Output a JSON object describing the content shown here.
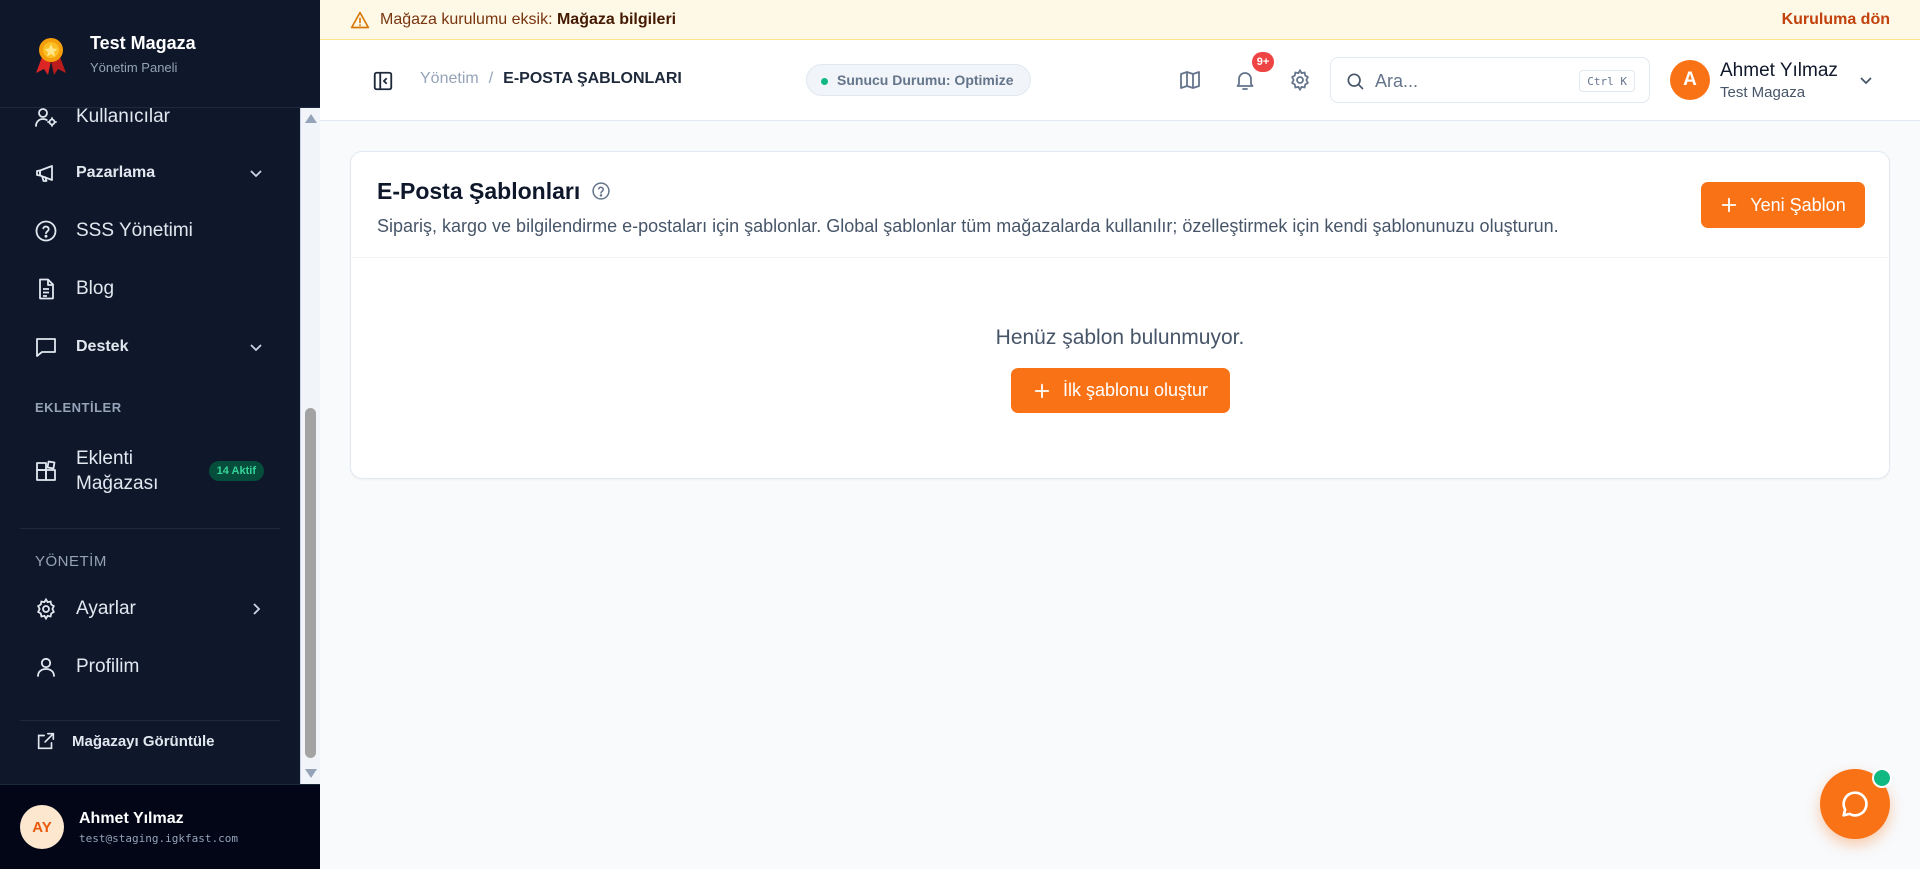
{
  "brand": {
    "title": "Test Magaza",
    "subtitle": "Yönetim Paneli"
  },
  "sidebar": {
    "items": [
      {
        "label": "Kullanıcılar",
        "icon": "users-gear-icon"
      },
      {
        "label": "Pazarlama",
        "icon": "megaphone-icon"
      },
      {
        "label": "SSS Yönetimi",
        "icon": "help-circle-icon"
      },
      {
        "label": "Blog",
        "icon": "file-text-icon"
      },
      {
        "label": "Destek",
        "icon": "message-square-icon"
      }
    ],
    "sections": {
      "plugins": "EKLENTİLER",
      "admin": "YÖNETİM"
    },
    "plugin_store": {
      "label": "Eklenti Mağazası",
      "badge": "14 Aktif"
    },
    "admin_items": [
      {
        "label": "Ayarlar",
        "icon": "gear-icon"
      },
      {
        "label": "Profilim",
        "icon": "user-icon"
      }
    ],
    "view_store": "Mağazayı Görüntüle"
  },
  "sidebar_user": {
    "initials": "AY",
    "name": "Ahmet Yılmaz",
    "email": "test@staging.igkfast.com"
  },
  "banner": {
    "text": "Mağaza kurulumu eksik:",
    "strong": "Mağaza bilgileri",
    "action": "Kuruluma dön"
  },
  "topbar": {
    "breadcrumb_root": "Yönetim",
    "breadcrumb_sep": "/",
    "breadcrumb_current": "E-POSTA ŞABLONLARI",
    "server_status": "Sunucu Durumu: Optimize",
    "notifications_badge": "9+",
    "search_placeholder": "Ara...",
    "search_shortcut": "Ctrl K",
    "user_initial": "A",
    "user_name": "Ahmet Yılmaz",
    "user_store": "Test Magaza"
  },
  "main": {
    "title": "E-Posta Şablonları",
    "description": "Sipariş, kargo ve bilgilendirme e-postaları için şablonlar. Global şablonlar tüm mağazalarda kullanılır; özelleştirmek için kendi şablonunuzu oluşturun.",
    "new_button": "Yeni Şablon",
    "empty_text": "Henüz şablon bulunmuyor.",
    "first_button": "İlk şablonu oluştur"
  },
  "colors": {
    "accent": "#f97316",
    "sidebar_bg": "#0f172a",
    "success": "#10b981"
  }
}
